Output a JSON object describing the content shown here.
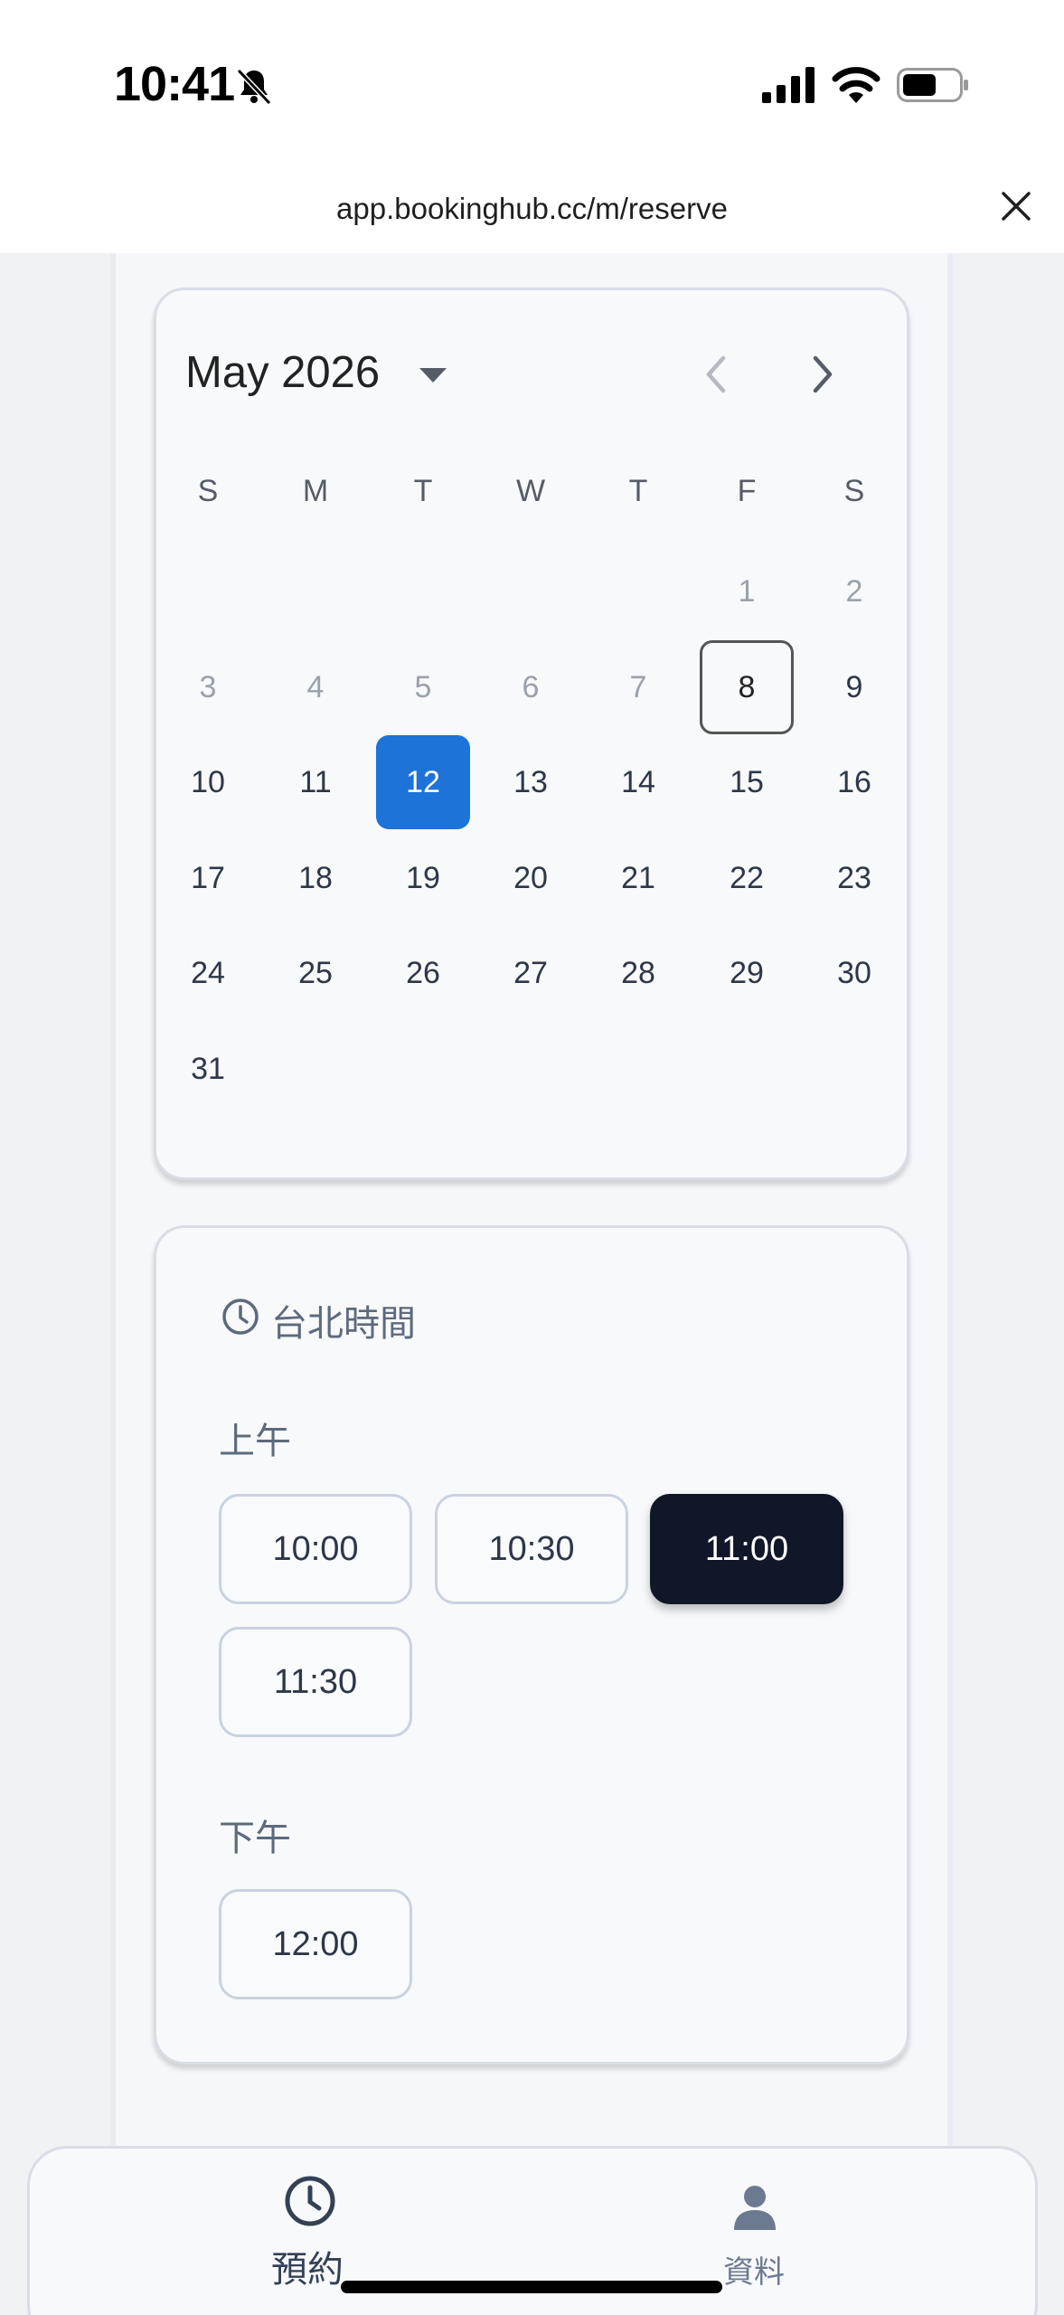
{
  "status_bar": {
    "time": "10:41"
  },
  "browser": {
    "url": "app.bookinghub.cc/m/reserve"
  },
  "calendar": {
    "month_label": "May 2026",
    "weekdays": [
      "S",
      "M",
      "T",
      "W",
      "T",
      "F",
      "S"
    ],
    "days": [
      {
        "n": "1",
        "state": "muted"
      },
      {
        "n": "2",
        "state": "muted"
      },
      {
        "n": "3",
        "state": "muted"
      },
      {
        "n": "4",
        "state": "muted"
      },
      {
        "n": "5",
        "state": "muted"
      },
      {
        "n": "6",
        "state": "muted"
      },
      {
        "n": "7",
        "state": "muted"
      },
      {
        "n": "8",
        "state": "today"
      },
      {
        "n": "9",
        "state": "normal"
      },
      {
        "n": "10",
        "state": "normal"
      },
      {
        "n": "11",
        "state": "normal"
      },
      {
        "n": "12",
        "state": "selected"
      },
      {
        "n": "13",
        "state": "normal"
      },
      {
        "n": "14",
        "state": "normal"
      },
      {
        "n": "15",
        "state": "normal"
      },
      {
        "n": "16",
        "state": "normal"
      },
      {
        "n": "17",
        "state": "normal"
      },
      {
        "n": "18",
        "state": "normal"
      },
      {
        "n": "19",
        "state": "normal"
      },
      {
        "n": "20",
        "state": "normal"
      },
      {
        "n": "21",
        "state": "normal"
      },
      {
        "n": "22",
        "state": "normal"
      },
      {
        "n": "23",
        "state": "normal"
      },
      {
        "n": "24",
        "state": "normal"
      },
      {
        "n": "25",
        "state": "normal"
      },
      {
        "n": "26",
        "state": "normal"
      },
      {
        "n": "27",
        "state": "normal"
      },
      {
        "n": "28",
        "state": "normal"
      },
      {
        "n": "29",
        "state": "normal"
      },
      {
        "n": "30",
        "state": "normal"
      },
      {
        "n": "31",
        "state": "normal"
      }
    ]
  },
  "time_picker": {
    "timezone_label": "台北時間",
    "morning_label": "上午",
    "afternoon_label": "下午",
    "morning_slots": [
      {
        "time": "10:00",
        "selected": false
      },
      {
        "time": "10:30",
        "selected": false
      },
      {
        "time": "11:00",
        "selected": true
      },
      {
        "time": "11:30",
        "selected": false
      }
    ],
    "afternoon_slots": [
      {
        "time": "12:00",
        "selected": false
      }
    ]
  },
  "bottom_nav": {
    "items": [
      {
        "label": "預約",
        "icon": "clock-icon",
        "active": true
      },
      {
        "label": "資料",
        "icon": "person-icon",
        "active": false
      }
    ]
  },
  "colors": {
    "accent": "#1e73d8",
    "selected_slot": "#101728",
    "label_muted": "#5c6a7d"
  }
}
